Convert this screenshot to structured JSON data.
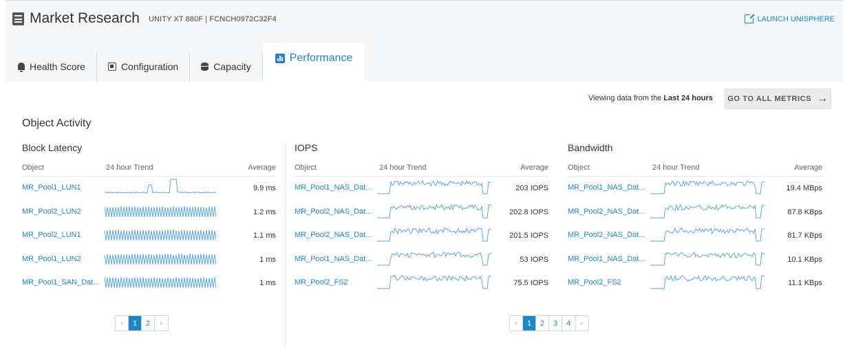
{
  "header": {
    "title": "Market Research",
    "subtitle": "UNITY XT 880F | FCNCH0972C32F4",
    "launch_label": "LAUNCH UNISPHERE"
  },
  "tabs": [
    {
      "label": "Health Score",
      "icon": "bell-icon"
    },
    {
      "label": "Configuration",
      "icon": "config-icon"
    },
    {
      "label": "Capacity",
      "icon": "capacity-icon"
    },
    {
      "label": "Performance",
      "icon": "chart-bar-icon",
      "active": true
    }
  ],
  "toolbar": {
    "viewing_prefix": "Viewing data from the",
    "viewing_range": "Last 24 hours",
    "goto_label": "GO TO ALL METRICS"
  },
  "section": {
    "title": "Object Activity"
  },
  "columns": {
    "object": "Object",
    "trend": "24 hour Trend",
    "average": "Average"
  },
  "panels": {
    "latency": {
      "title": "Block Latency",
      "rows": [
        {
          "object": "MR_Pool1_LUN1",
          "average": "9.9 ms",
          "trend": "spiky"
        },
        {
          "object": "MR_Pool2_LUN2",
          "average": "1.2 ms",
          "trend": "periodic"
        },
        {
          "object": "MR_Pool2_LUN1",
          "average": "1.1 ms",
          "trend": "periodic"
        },
        {
          "object": "MR_Pool1_LUN2",
          "average": "1 ms",
          "trend": "periodic"
        },
        {
          "object": "MR_Pool1_SAN_Dat...",
          "average": "1 ms",
          "trend": "periodic"
        }
      ],
      "pages": [
        "1",
        "2"
      ],
      "current_page": "1"
    },
    "iops": {
      "title": "IOPS",
      "rows": [
        {
          "object": "MR_Pool1_NAS_Dat...",
          "average": "203 IOPS",
          "trend": "dense"
        },
        {
          "object": "MR_Pool2_NAS_Dat...",
          "average": "202.8 IOPS",
          "trend": "dense"
        },
        {
          "object": "MR_Pool2_NAS_Dat...",
          "average": "201.5 IOPS",
          "trend": "dense"
        },
        {
          "object": "MR_Pool1_NAS_Dat...",
          "average": "53 IOPS",
          "trend": "dense"
        },
        {
          "object": "MR_Pool2_FS2",
          "average": "75.5 IOPS",
          "trend": "dense"
        }
      ],
      "pages": [
        "1",
        "2",
        "3",
        "4"
      ],
      "current_page": "1"
    },
    "bandwidth": {
      "title": "Bandwidth",
      "rows": [
        {
          "object": "MR_Pool1_NAS_Dat...",
          "average": "19.4 MBps",
          "trend": "dense"
        },
        {
          "object": "MR_Pool2_NAS_Dat...",
          "average": "87.8 KBps",
          "trend": "dense"
        },
        {
          "object": "MR_Pool2_NAS_Dat...",
          "average": "81.7 KBps",
          "trend": "dense"
        },
        {
          "object": "MR_Pool1_NAS_Dat...",
          "average": "10.1 KBps",
          "trend": "dense"
        },
        {
          "object": "MR_Pool2_FS2",
          "average": "11.1 KBps",
          "trend": "dense"
        }
      ],
      "pages": [],
      "current_page": ""
    }
  },
  "colors": {
    "accent": "#1f86c8",
    "spark": "#5aa6dc"
  }
}
